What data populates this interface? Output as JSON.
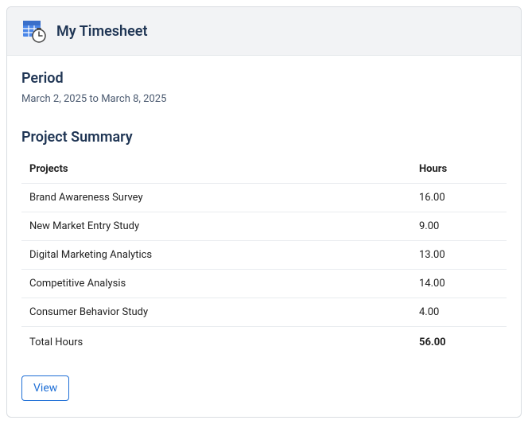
{
  "header": {
    "title": "My Timesheet"
  },
  "period": {
    "label": "Period",
    "range": "March 2, 2025 to March 8, 2025"
  },
  "summary": {
    "heading": "Project Summary",
    "columns": {
      "project": "Projects",
      "hours": "Hours"
    },
    "rows": [
      {
        "project": "Brand Awareness Survey",
        "hours": "16.00"
      },
      {
        "project": "New Market Entry Study",
        "hours": "9.00"
      },
      {
        "project": "Digital Marketing Analytics",
        "hours": "13.00"
      },
      {
        "project": "Competitive Analysis",
        "hours": "14.00"
      },
      {
        "project": "Consumer Behavior Study",
        "hours": "4.00"
      }
    ],
    "total": {
      "label": "Total Hours",
      "value": "56.00"
    }
  },
  "actions": {
    "view_label": "View"
  }
}
